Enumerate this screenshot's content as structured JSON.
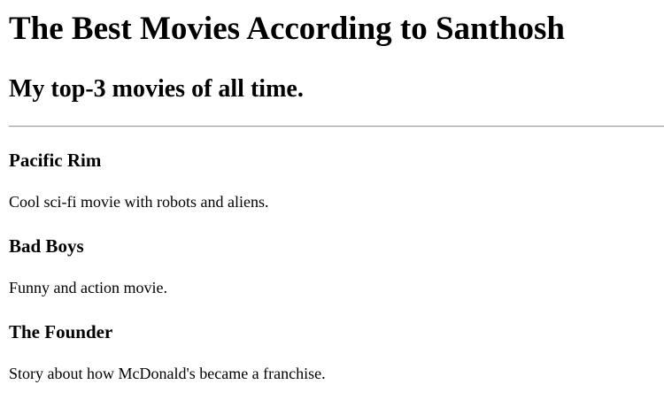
{
  "page": {
    "title": "The Best Movies According to Santhosh",
    "subtitle": "My top-3 movies of all time."
  },
  "movies": [
    {
      "title": "Pacific Rim",
      "description": "Cool sci-fi movie with robots and aliens."
    },
    {
      "title": "Bad Boys",
      "description": "Funny and action movie."
    },
    {
      "title": "The Founder",
      "description": "Story about how McDonald's became a franchise."
    }
  ]
}
